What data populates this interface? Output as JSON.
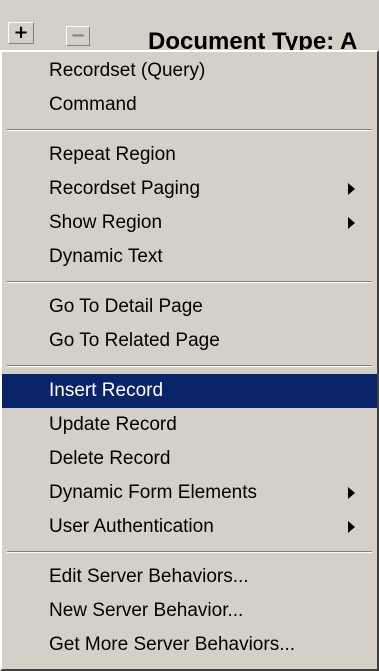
{
  "toolbar": {
    "plus_label": "+",
    "minus_label": "−",
    "document_type": "Document Type: A"
  },
  "menu": {
    "group1": [
      "Recordset (Query)",
      "Command"
    ],
    "group2": [
      "Repeat Region",
      "Recordset Paging",
      "Show Region",
      "Dynamic Text"
    ],
    "group3": [
      "Go To Detail Page",
      "Go To Related Page"
    ],
    "group4": [
      "Insert Record",
      "Update Record",
      "Delete Record",
      "Dynamic Form Elements",
      "User Authentication"
    ],
    "group5": [
      "Edit Server Behaviors...",
      "New Server Behavior...",
      "Get More Server Behaviors..."
    ],
    "highlighted": "Insert Record"
  },
  "colors": {
    "menu_bg": "#d4d0c8",
    "highlight_bg": "#0a246a",
    "highlight_text": "#ffffff"
  }
}
